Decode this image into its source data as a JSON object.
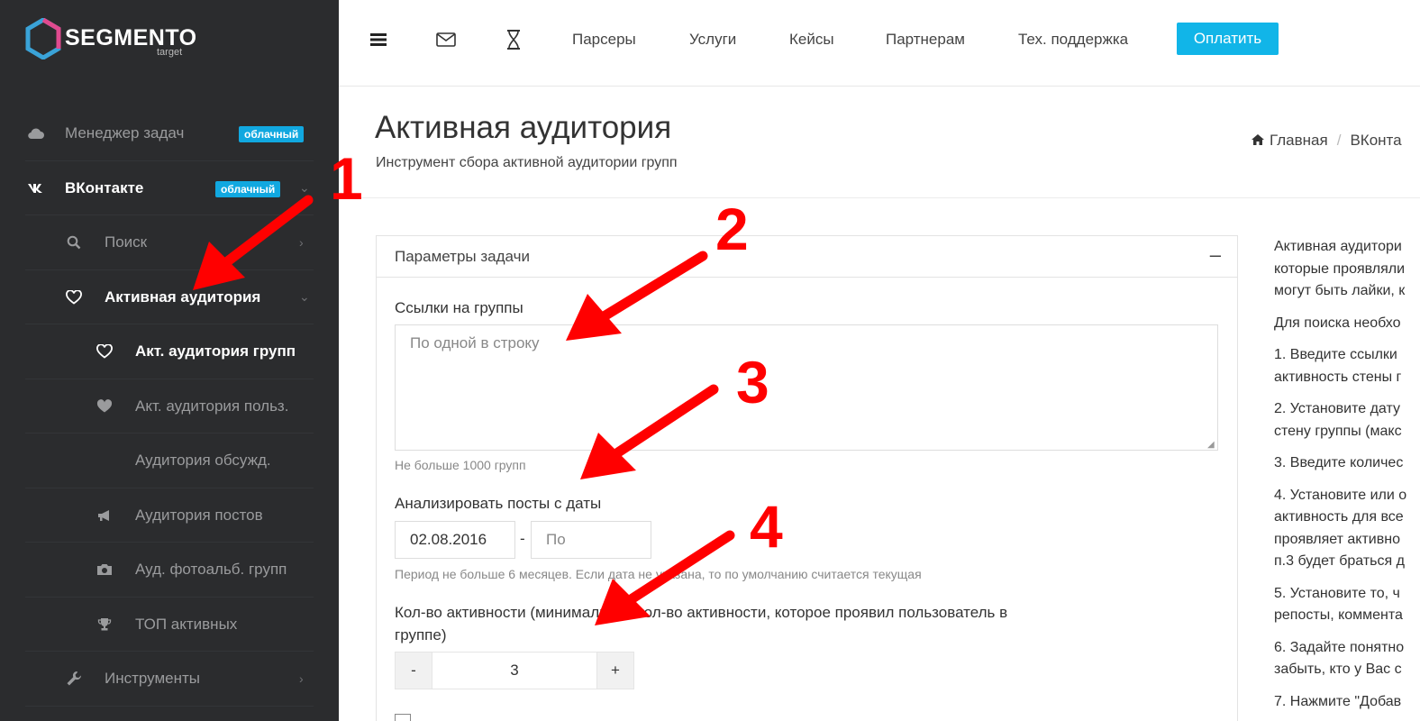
{
  "brand": {
    "name": "SEGMENTO",
    "sub": "target"
  },
  "sidebar": {
    "items": [
      {
        "label": "Менеджер задач",
        "icon": "cloud-icon",
        "badge": "облачный"
      },
      {
        "label": "ВКонтакте",
        "icon": "vk-icon",
        "badge": "облачный"
      },
      {
        "label": "Поиск",
        "icon": "search-icon"
      },
      {
        "label": "Активная аудитория",
        "icon": "heart-outline-icon"
      },
      {
        "label": "Акт. аудитория групп",
        "icon": "heart-outline-icon"
      },
      {
        "label": "Акт. аудитория польз.",
        "icon": "heart-filled-icon"
      },
      {
        "label": "Аудитория обсужд.",
        "icon": "none"
      },
      {
        "label": "Аудитория постов",
        "icon": "bullhorn-icon"
      },
      {
        "label": "Ауд. фотоальб. групп",
        "icon": "camera-icon"
      },
      {
        "label": "ТОП активных",
        "icon": "trophy-icon"
      },
      {
        "label": "Инструменты",
        "icon": "wrench-icon"
      }
    ]
  },
  "topbar": {
    "links": [
      "Парсеры",
      "Услуги",
      "Кейсы",
      "Партнерам",
      "Тех. поддержка"
    ],
    "pay": "Оплатить"
  },
  "page": {
    "title": "Активная аудитория",
    "subtitle": "Инструмент сбора активной аудитории групп",
    "breadcrumb": [
      "Главная",
      "ВКонта"
    ]
  },
  "form": {
    "panel_title": "Параметры задачи",
    "panel_toggle": "–",
    "groups_label": "Ссылки на группы",
    "groups_placeholder": "По одной в строку",
    "groups_help": "Не больше 1000 групп",
    "date_label": "Анализировать посты с даты",
    "date_from": "02.08.2016",
    "date_sep": "-",
    "date_to_placeholder": "По",
    "date_help": "Период не больше 6 месяцев. Если дата не указана, то по умолчанию считается текущая",
    "activity_label_1": "Кол-во активности (минимальное кол-во активности, которое проявил пользователь в",
    "activity_label_2": "группе)",
    "minus": "-",
    "plus": "+",
    "activity_value": "3"
  },
  "help_column": [
    "Активная аудитори",
    "которые проявляли",
    "могут быть лайки, к",
    "Для поиска необхо",
    "1. Введите ссылки",
    "активность стены г",
    "2. Установите дату",
    "стену группы (макс",
    "3. Введите количес",
    "4. Установите или о",
    "активность для все",
    "проявляет активно",
    "п.3 будет браться д",
    "5. Установите то, ч",
    "репосты, коммента",
    "6. Задайте понятно",
    "забыть, кто у Вас с",
    "7. Нажмите \"Добав"
  ],
  "annotations": [
    "1",
    "2",
    "3",
    "4"
  ],
  "colors": {
    "sidebar_bg": "#2b2c2e",
    "accent": "#11b5e8",
    "arrow": "#ff0000"
  }
}
